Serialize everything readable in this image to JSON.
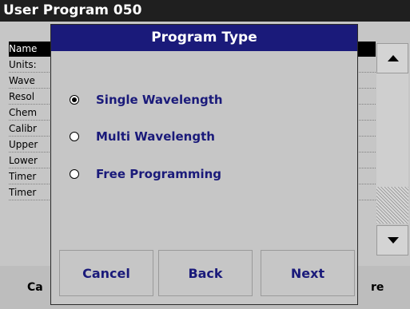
{
  "window": {
    "title": "User Program   050"
  },
  "list": {
    "rows": [
      {
        "label": "Name"
      },
      {
        "label": "Units:"
      },
      {
        "label": "Wave"
      },
      {
        "label": "Resol"
      },
      {
        "label": "Chem"
      },
      {
        "label": "Calibr"
      },
      {
        "label": "Upper"
      },
      {
        "label": "Lower"
      },
      {
        "label": "Timer"
      },
      {
        "label": "Timer"
      }
    ]
  },
  "bottombar": {
    "left_label": "Ca",
    "right_label": "re"
  },
  "dialog": {
    "title": "Program Type",
    "options": [
      {
        "label": "Single Wavelength",
        "selected": true
      },
      {
        "label": "Multi Wavelength",
        "selected": false
      },
      {
        "label": "Free Programming",
        "selected": false
      }
    ],
    "buttons": {
      "cancel": "Cancel",
      "back": "Back",
      "next": "Next"
    }
  }
}
